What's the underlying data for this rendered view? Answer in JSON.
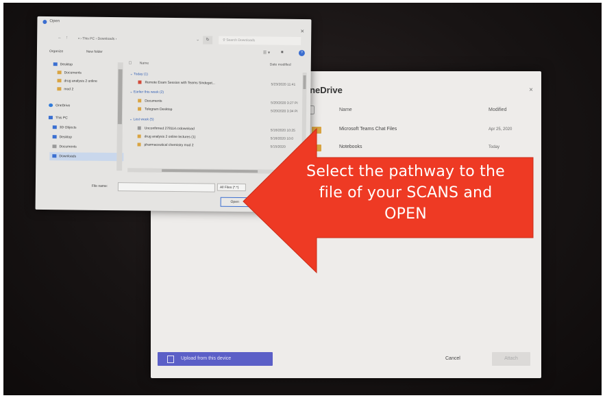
{
  "open_dialog": {
    "title": "Open",
    "address": [
      "This PC",
      "Downloads"
    ],
    "search_placeholder": "Search Downloads",
    "toolbar": {
      "organize": "Organize",
      "new_folder": "New folder"
    },
    "nav_items": [
      {
        "label": "Desktop",
        "color": "#3a6fd1",
        "selected": false
      },
      {
        "label": "Documents",
        "color": "#d9a441",
        "selected": false
      },
      {
        "label": "drug analysis 2 online",
        "color": "#d9a441",
        "selected": false
      },
      {
        "label": "mod 2",
        "color": "#d9a441",
        "selected": false
      },
      {
        "label": "OneDrive",
        "color": "#2f7ad9",
        "selected": false
      },
      {
        "label": "This PC",
        "color": "#3a6fd1",
        "selected": false
      },
      {
        "label": "3D Objects",
        "color": "#3a6fd1",
        "selected": false
      },
      {
        "label": "Desktop",
        "color": "#3a6fd1",
        "selected": false
      },
      {
        "label": "Documents",
        "color": "#999999",
        "selected": false
      },
      {
        "label": "Downloads",
        "color": "#3a6fd1",
        "selected": true
      }
    ],
    "columns": {
      "name": "Name",
      "date_modified": "Date modified"
    },
    "groups": [
      {
        "label": "Today (1)",
        "files": [
          {
            "name": "Remote Exam Session with Teams Sindeget...",
            "date": "5/23/2020 11:41",
            "color": "#d14b3a"
          }
        ]
      },
      {
        "label": "Earlier this week (2)",
        "files": [
          {
            "name": "Documents",
            "date": "5/20/2020 3:27 PI",
            "color": "#d9a441"
          },
          {
            "name": "Telegram Desktop",
            "date": "5/20/2020 3:34 PI",
            "color": "#d9a441"
          }
        ]
      },
      {
        "label": "Last week (5)",
        "files": [
          {
            "name": "Unconfirmed 278114.crdownload",
            "date": "5/16/2020 10:25",
            "color": "#999999"
          },
          {
            "name": "drug analysis 2 online lectures (1)",
            "date": "5/16/2020 10:0",
            "color": "#d9a441"
          },
          {
            "name": "pharmaceutical chemistry mod 2",
            "date": "5/15/2020",
            "color": "#d9a441"
          }
        ]
      }
    ],
    "file_name_label": "File name:",
    "file_type": "All Files (*.*)",
    "open_button": "Open"
  },
  "onedrive": {
    "title": "OneDrive",
    "close": "×",
    "columns": {
      "name": "Name",
      "modified": "Modified"
    },
    "rows": [
      {
        "name": "Microsoft Teams Chat Files",
        "modified": "Apr 25, 2020"
      },
      {
        "name": "Notebooks",
        "modified": "Today"
      }
    ],
    "upload_button": "Upload from this device",
    "cancel_button": "Cancel",
    "attach_button": "Attach"
  },
  "callout": {
    "lines": [
      "Select the pathway to the",
      "file of your SCANS and",
      "OPEN"
    ],
    "color": "#ee3a24"
  }
}
